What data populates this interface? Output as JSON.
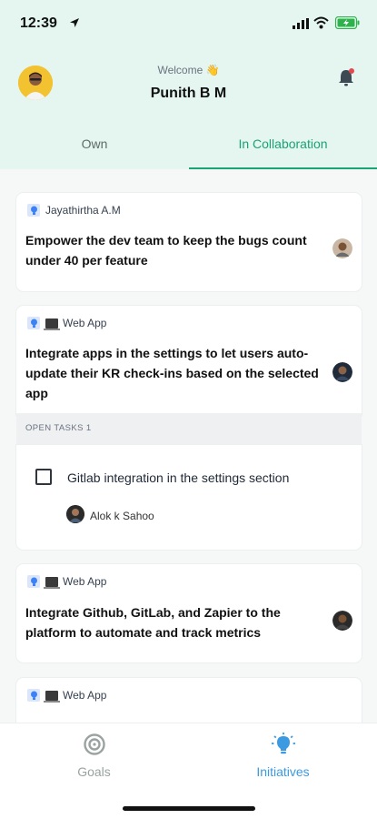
{
  "status_bar": {
    "time": "12:39"
  },
  "header": {
    "welcome": "Welcome 👋",
    "user_name": "Punith B M"
  },
  "tabs": [
    {
      "label": "Own",
      "active": false
    },
    {
      "label": "In Collaboration",
      "active": true
    }
  ],
  "cards": [
    {
      "meta": "Jayathirtha A.M",
      "title": "Empower the dev team to keep the bugs count under 40 per feature"
    },
    {
      "meta": "Web App",
      "title": "Integrate apps in the settings to let users auto-update their KR check-ins based on the selected app"
    },
    {
      "meta": "Web App",
      "title": "Integrate Github, GitLab, and Zapier to the platform to automate and track metrics"
    },
    {
      "meta": "Web App",
      "title": ""
    }
  ],
  "open_tasks": {
    "label": "OPEN TASKS  1",
    "tasks": [
      {
        "title": "Gitlab integration in the settings section",
        "assignee": "Alok k Sahoo",
        "done": false
      }
    ]
  },
  "bottom_nav": [
    {
      "label": "Goals",
      "icon": "target-icon",
      "active": false
    },
    {
      "label": "Initiatives",
      "icon": "lightbulb-icon",
      "active": true
    }
  ],
  "colors": {
    "accent": "#1aa375",
    "nav_active": "#3b9ae1",
    "header_bg": "#e4f6ef"
  }
}
